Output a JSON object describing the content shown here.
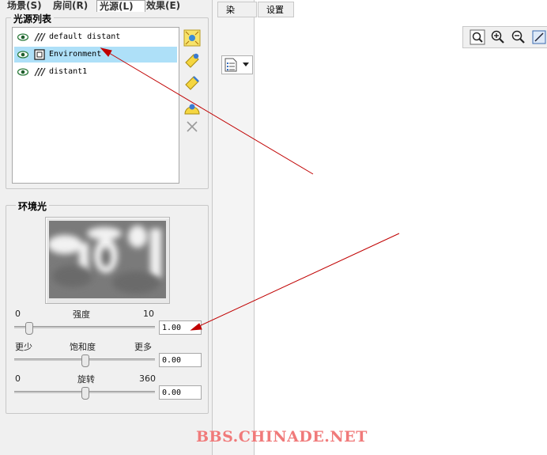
{
  "tabs": [
    {
      "label": "场景(S)"
    },
    {
      "label": "房间(R)"
    },
    {
      "label": "光源(L)"
    },
    {
      "label": "效果(E)"
    }
  ],
  "top_tabs": [
    {
      "label": "染"
    },
    {
      "label": "设置"
    }
  ],
  "light_list": {
    "title": "光源列表",
    "items": [
      {
        "name": "default distant",
        "type_icon": "distant-light-icon"
      },
      {
        "name": "Environment",
        "type_icon": "environment-light-icon"
      },
      {
        "name": "distant1",
        "type_icon": "distant-light-icon"
      }
    ],
    "selected_index": 1
  },
  "toolbox": [
    "add-spot-light-icon",
    "add-area-light-icon",
    "add-distant-light-icon",
    "add-point-light-icon",
    "delete-icon"
  ],
  "ambient": {
    "title": "环境光",
    "intensity": {
      "label": "强度",
      "min": "0",
      "max": "10",
      "value": "1.00",
      "level": 0.1
    },
    "saturation": {
      "label": "饱和度",
      "min": "更少",
      "max": "更多",
      "value": "0.00",
      "level": 0.5
    },
    "rotation": {
      "label": "旋转",
      "min": "0",
      "max": "360",
      "value": "0.00",
      "level": 0.5
    }
  },
  "view_toolbar": [
    "zoom-fit-icon",
    "zoom-in-icon",
    "zoom-out-icon",
    "region-zoom-icon"
  ],
  "colors": {
    "accent_selection": "#aee0f8",
    "annotation_arrow": "#c00000",
    "watermark": "#f07a7a"
  },
  "watermark": "BBS.CHINADE.NET"
}
